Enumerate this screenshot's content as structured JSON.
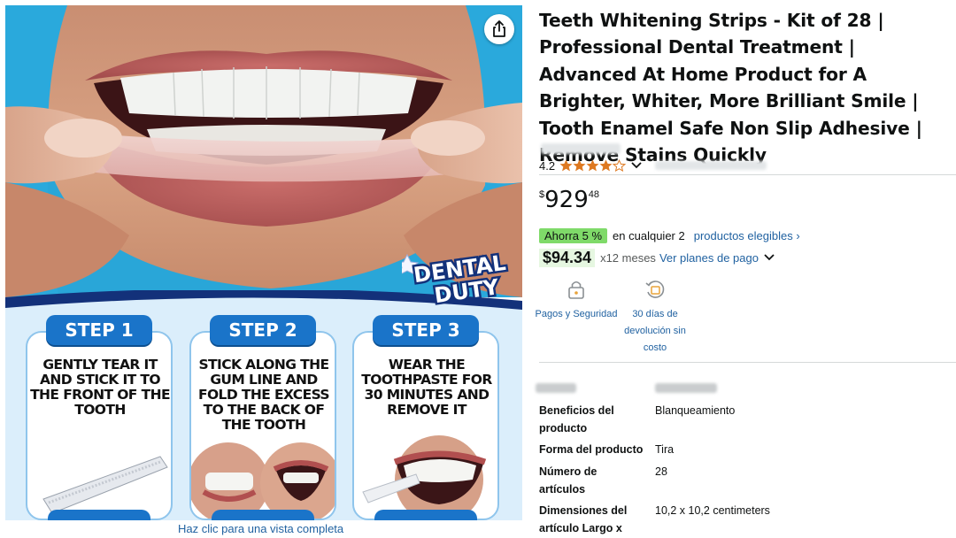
{
  "gallery": {
    "badge_text": [
      "DENTAL",
      "DUTY"
    ],
    "steps": [
      {
        "label": "STEP 1",
        "text": "GENTLY TEAR IT AND STICK IT TO THE FRONT OF THE TOOTH"
      },
      {
        "label": "STEP 2",
        "text": "STICK ALONG THE GUM LINE AND FOLD THE EXCESS TO THE BACK OF THE TOOTH"
      },
      {
        "label": "STEP 3",
        "text": "WEAR THE TOOTHPASTE FOR 30 MINUTES AND REMOVE IT"
      }
    ],
    "full_view_link": "Haz clic para una vista completa",
    "share_icon": "share-icon"
  },
  "product": {
    "title": "Teeth Whitening Strips - Kit of 28 | Professional Dental Treatment | Advanced At Home Product for A Brighter, Whiter, More Brilliant Smile | Tooth Enamel Safe Non Slip Adhesive | Remove Stains Quickly",
    "rating": "4.2",
    "rating_stars": 4.2,
    "price": {
      "symbol": "$",
      "whole": "929",
      "fraction": "48"
    },
    "promo": {
      "badge": "Ahorra 5 %",
      "qualifier": "en cualquier 2",
      "link": "productos elegibles ›"
    },
    "installments": {
      "amount": "$94.34",
      "term": "x12 meses",
      "link": "Ver planes de pago"
    },
    "features": [
      {
        "icon": "lock-icon",
        "label": "Pagos y Seguridad"
      },
      {
        "icon": "return-box-icon",
        "label": "30 días de devolución sin costo"
      }
    ],
    "specs": [
      {
        "key": "Beneficios del producto",
        "value": "Blanqueamiento"
      },
      {
        "key": "Forma del producto",
        "value": "Tira"
      },
      {
        "key": "Número de artículos",
        "value": "28"
      },
      {
        "key": "Dimensiones del artículo Largo x",
        "value": "10,2 x 10,2 centimeters"
      }
    ]
  },
  "colors": {
    "link": "#2162a1",
    "star": "#de7921",
    "save_badge": "#7fda69",
    "step_blue": "#1a74c9"
  }
}
